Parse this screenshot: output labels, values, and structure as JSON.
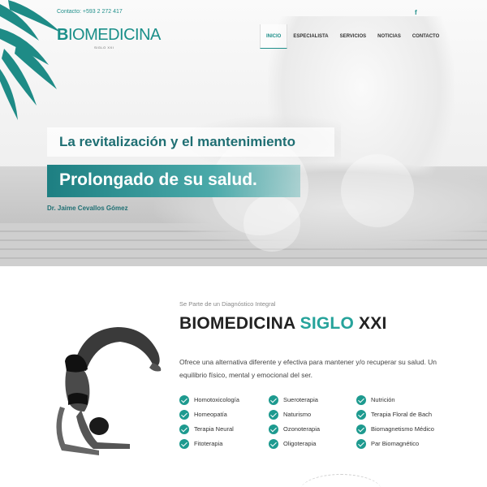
{
  "header": {
    "contact": "Contacto: +593 2 272 417",
    "social_icon": "f",
    "logo_bold": "B",
    "logo_rest": "IOMEDICINA",
    "logo_sub": "SIGLO XXI"
  },
  "nav": {
    "items": [
      "INICIO",
      "ESPECIALISTA",
      "SERVICIOS",
      "NOTICIAS",
      "CONTACTO"
    ],
    "active": "INICIO"
  },
  "hero": {
    "line1": "La revitalización y el mantenimiento",
    "line2": "Prolongado de su salud.",
    "author": "Dr. Jaime Cevallos Gómez"
  },
  "intro": {
    "kicker": "Se Parte de un Diagnóstico Integral",
    "title_main": "BIOMEDICINA",
    "title_accent": "SIGLO",
    "title_end": "XXI",
    "description": "Ofrece una alternativa diferente y efectiva para mantener y/o recuperar su salud. Un equilibrio físico, mental y emocional del ser."
  },
  "features": {
    "col1": [
      "Homotoxicología",
      "Homeopatía",
      "Terapia Neural",
      "Fitoterapia"
    ],
    "col2": [
      "Sueroterapia",
      "Naturismo",
      "Ozonoterapia",
      "Oligoterapia"
    ],
    "col3": [
      "Nutrición",
      "Terapia Floral de Bach",
      "Biomagnetismo Médico",
      "Par Biomagnético"
    ]
  },
  "colors": {
    "brand": "#1f8f8a",
    "accent": "#26a39b"
  }
}
